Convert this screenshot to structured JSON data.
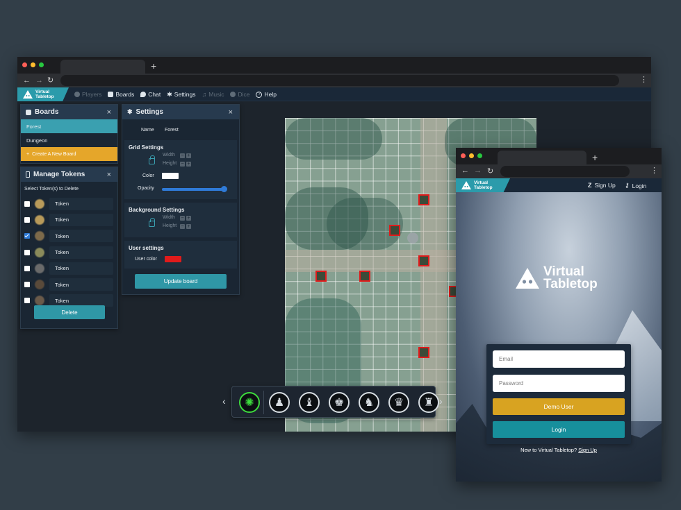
{
  "main_window": {
    "new_tab": "+",
    "nav_buttons": {
      "back": "←",
      "forward": "→",
      "reload": "↻"
    },
    "menu": "⋮",
    "app_nav": {
      "logo": {
        "line1": "Virtual",
        "line2": "Tabletop"
      },
      "items": [
        {
          "label": "Players",
          "icon": "players-icon",
          "enabled": false
        },
        {
          "label": "Boards",
          "icon": "boards-icon",
          "enabled": true
        },
        {
          "label": "Chat",
          "icon": "chat-icon",
          "enabled": true
        },
        {
          "label": "Settings",
          "icon": "gear-icon",
          "enabled": true
        },
        {
          "label": "Music",
          "icon": "music-icon",
          "enabled": false
        },
        {
          "label": "Dice",
          "icon": "dice-icon",
          "enabled": false
        },
        {
          "label": "Help",
          "icon": "help-icon",
          "enabled": true
        }
      ]
    }
  },
  "boards_panel": {
    "title": "Boards",
    "close": "×",
    "items": [
      "Forest",
      "Dungeon"
    ],
    "active": "Forest",
    "create_label": "Create A New Board",
    "create_icon": "+"
  },
  "tokens_panel": {
    "title": "Manage Tokens",
    "close": "×",
    "subtitle": "Select Token(s) to Delete",
    "tokens": [
      {
        "name": "Token",
        "checked": false
      },
      {
        "name": "Token",
        "checked": false
      },
      {
        "name": "Token",
        "checked": true
      },
      {
        "name": "Token",
        "checked": false
      },
      {
        "name": "Token",
        "checked": false
      },
      {
        "name": "Token",
        "checked": false
      },
      {
        "name": "Token",
        "checked": false
      }
    ],
    "delete_label": "Delete"
  },
  "settings_panel": {
    "title": "Settings",
    "close": "×",
    "name_label": "Name",
    "name_value": "Forest",
    "grid": {
      "title": "Grid Settings",
      "width_label": "Width",
      "height_label": "Height",
      "color_label": "Color",
      "color_value": "#ffffff",
      "opacity_label": "Opacity",
      "opacity_value": 1.0
    },
    "background": {
      "title": "Background Settings",
      "width_label": "Width",
      "height_label": "Height"
    },
    "user": {
      "title": "User settings",
      "color_label": "User color",
      "color_value": "#e01b1b"
    },
    "update_label": "Update board",
    "minus": "−",
    "plus": "+"
  },
  "piece_toolbar": {
    "prev": "‹",
    "next": "›",
    "pieces": [
      "selected-token-icon",
      "pawn-icon",
      "bishop-icon",
      "king-icon",
      "knight-icon",
      "queen-icon",
      "rook-icon"
    ],
    "glyphs": [
      "✺",
      "♟",
      "♝",
      "♚",
      "♞",
      "♛",
      "♜"
    ]
  },
  "phone_window": {
    "new_tab": "+",
    "nav_buttons": {
      "back": "←",
      "forward": "→",
      "reload": "↻"
    },
    "menu": "⋮",
    "logo": {
      "line1": "Virtual",
      "line2": "Tabletop"
    },
    "signup_nav": "Sign Up",
    "login_nav": "Login",
    "brand": {
      "line1": "Virtual",
      "line2": "Tabletop"
    },
    "email_placeholder": "Email",
    "password_placeholder": "Password",
    "demo_label": "Demo User",
    "login_label": "Login",
    "footer_text": "New to Virtual Tabletop?",
    "footer_link": "Sign Up"
  }
}
